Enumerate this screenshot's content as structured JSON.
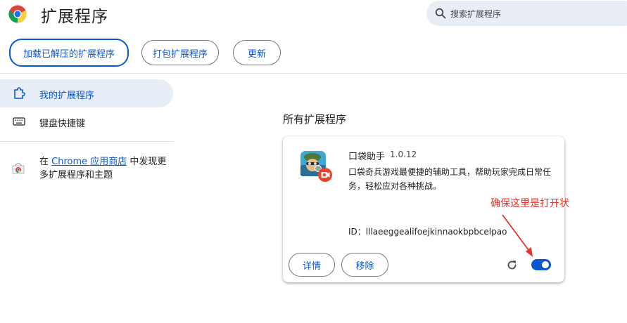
{
  "header": {
    "title": "扩展程序",
    "search_placeholder": "搜索扩展程序"
  },
  "toolbar": {
    "load_unpacked": "加载已解压的扩展程序",
    "pack": "打包扩展程序",
    "update": "更新"
  },
  "sidebar": {
    "items": [
      {
        "label": "我的扩展程序",
        "icon": "puzzle-icon",
        "active": true
      },
      {
        "label": "键盘快捷键",
        "icon": "keyboard-icon",
        "active": false
      }
    ],
    "store": {
      "prefix": "在 ",
      "link": "Chrome 应用商店",
      "suffix": " 中发现更多扩展程序和主题"
    }
  },
  "main": {
    "section_title": "所有扩展程序",
    "extension": {
      "name": "口袋助手",
      "version": "1.0.12",
      "description": "口袋奇兵游戏最便捷的辅助工具，帮助玩家完成日常任务，轻松应对各种挑战。",
      "id": "ID：lllaeeggealifoejkinnaokbpbcelpao",
      "details_label": "详情",
      "remove_label": "移除",
      "enabled": true
    }
  },
  "annotation": {
    "text": "确保这里是打开状",
    "color": "#e8322c"
  },
  "colors": {
    "accent": "#0b57d0",
    "active_bg": "#e8eef8",
    "search_bg": "#e9eef6"
  }
}
